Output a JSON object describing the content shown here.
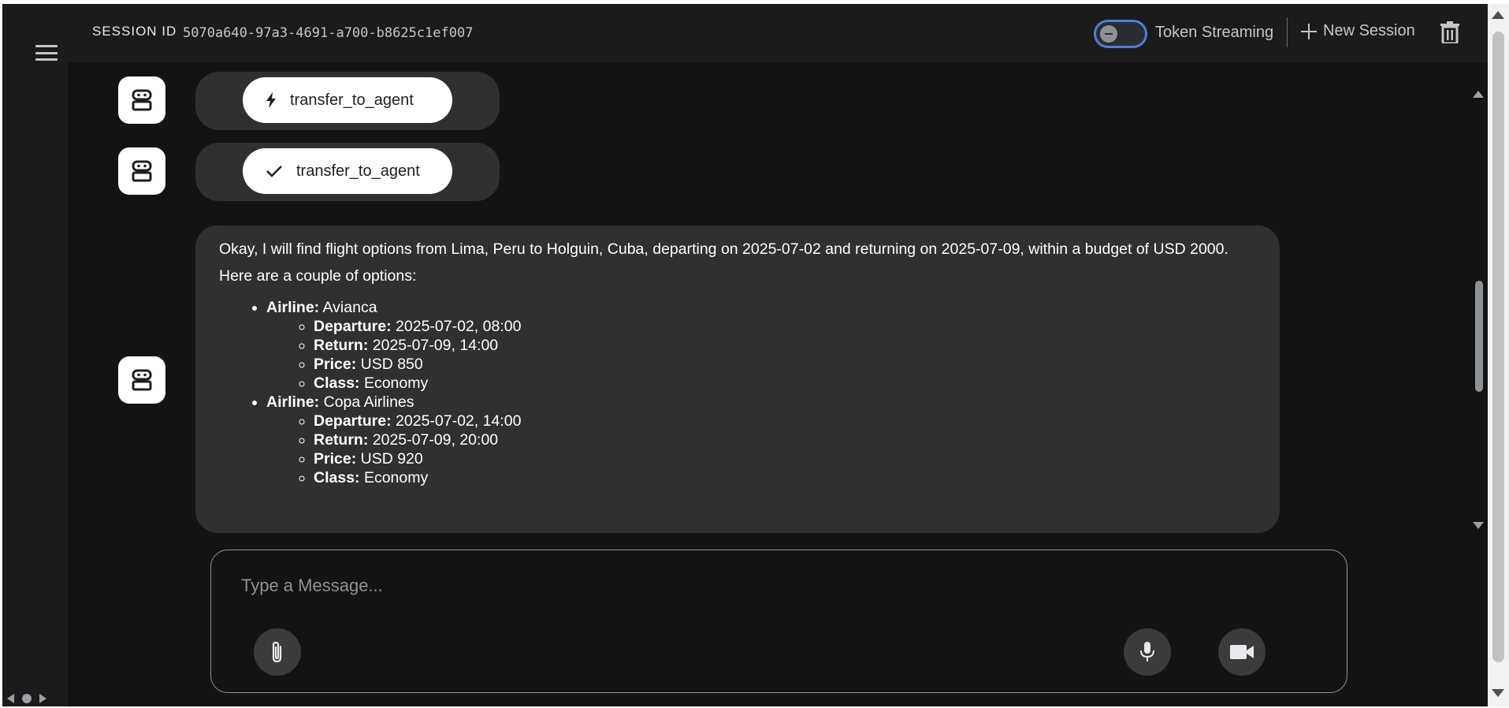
{
  "header": {
    "session_label": "SESSION ID",
    "session_id": "5070a640-97a3-4691-a700-b8625c1ef007",
    "token_streaming_label": "Token Streaming",
    "new_session_label": "New Session"
  },
  "icons": {
    "menu": "menu-icon",
    "toggle": "toggle-icon",
    "plus": "plus-icon",
    "trash": "trash-icon",
    "bot": "robot-icon",
    "bolt": "bolt-icon",
    "check": "check-icon",
    "attach": "paperclip-icon",
    "mic": "microphone-icon",
    "video": "video-camera-icon"
  },
  "colors": {
    "background": "#131314",
    "panel": "#1b1b1c",
    "bubble": "#303030",
    "accent": "#4f7fd1"
  },
  "messages": [
    {
      "type": "tool_call",
      "label": "transfer_to_agent"
    },
    {
      "type": "tool_result",
      "label": "transfer_to_agent"
    },
    {
      "type": "text",
      "intro": "Okay, I will find flight options from Lima, Peru to Holguin, Cuba, departing on 2025-07-02 and returning on 2025-07-09, within a budget of USD 2000.",
      "lead": "Here are a couple of options:",
      "options": [
        {
          "airline_key": "Airline:",
          "airline": "Avianca",
          "details": [
            {
              "key": "Departure:",
              "value": "2025-07-02, 08:00"
            },
            {
              "key": "Return:",
              "value": "2025-07-09, 14:00"
            },
            {
              "key": "Price:",
              "value": "USD 850"
            },
            {
              "key": "Class:",
              "value": "Economy"
            }
          ]
        },
        {
          "airline_key": "Airline:",
          "airline": "Copa Airlines",
          "details": [
            {
              "key": "Departure:",
              "value": "2025-07-02, 14:00"
            },
            {
              "key": "Return:",
              "value": "2025-07-09, 20:00"
            },
            {
              "key": "Price:",
              "value": "USD 920"
            },
            {
              "key": "Class:",
              "value": "Economy"
            }
          ]
        }
      ]
    }
  ],
  "composer": {
    "placeholder": "Type a Message..."
  }
}
